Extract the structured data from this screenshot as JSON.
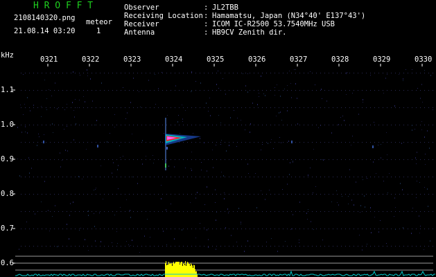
{
  "app": {
    "title": "H R O F F T"
  },
  "file": {
    "name": "2108140320.png",
    "datetime": "21.08.14 03:20",
    "meteor_label": "meteor",
    "meteor_count": "1"
  },
  "info": [
    {
      "key": "Observer",
      "sep": ":",
      "value": "JL2TBB"
    },
    {
      "key": "Receiving Location",
      "sep": ":",
      "value": "Hamamatsu, Japan (N34°40' E137°43')"
    },
    {
      "key": "Receiver",
      "sep": ":",
      "value": "ICOM IC-R2500 53.7540MHz USB"
    },
    {
      "key": "Antenna",
      "sep": ":",
      "value": "HB9CV Zenith dir."
    }
  ],
  "axes": {
    "y_unit": "kHz",
    "x_ticks": [
      "0321",
      "0322",
      "0323",
      "0324",
      "0325",
      "0326",
      "0327",
      "0328",
      "0329",
      "0330"
    ],
    "y_ticks": [
      "1.1",
      "1.0",
      "0.9",
      "0.8",
      "0.7",
      "0.6"
    ]
  },
  "colors": {
    "background": "#000000",
    "title": "#1fd01f",
    "text": "#ffffff",
    "signal_bar": "#ffff00",
    "noise_line": "#00c8c8",
    "grid_dot": "#2a2a55"
  }
}
